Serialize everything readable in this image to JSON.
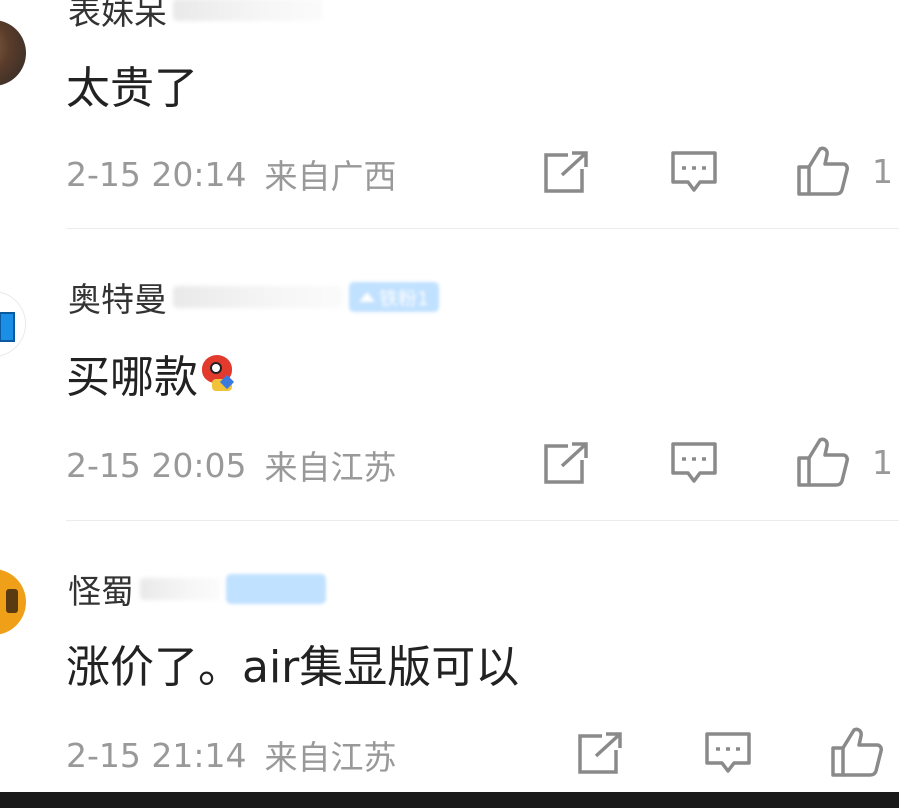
{
  "comments": [
    {
      "username": "表妹呆",
      "text": "太贵了",
      "time": "2-15 20:14",
      "location": "来自广西",
      "likes": "1"
    },
    {
      "username": "奥特曼",
      "fan_badge": "铁粉1",
      "text": "买哪款",
      "emoji": "weibo-eye-emoji",
      "time": "2-15 20:05",
      "location": "来自江苏",
      "likes": "1"
    },
    {
      "username": "怪蜀",
      "text": "涨价了。air集显版可以",
      "time": "2-15 21:14",
      "location": "来自江苏",
      "likes": ""
    }
  ],
  "icons": {
    "share": "share-icon",
    "reply": "comment-icon",
    "like": "thumbs-up-icon"
  },
  "colors": {
    "text": "#222222",
    "meta": "#999999",
    "icon": "#8a8a8a",
    "badge": "#9fd1ff"
  }
}
